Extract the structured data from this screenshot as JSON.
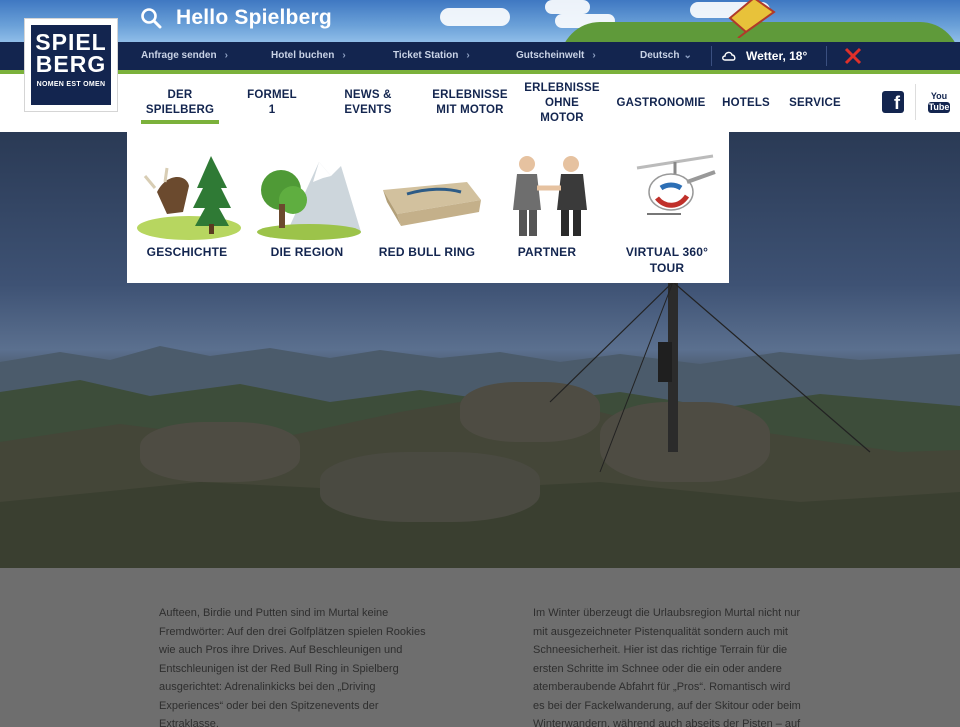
{
  "search": {
    "icon": "search-icon",
    "greeting": "Hello Spielberg"
  },
  "utility": {
    "links": [
      "Anfrage senden",
      "Hotel buchen",
      "Ticket Station",
      "Gutscheinwelt"
    ],
    "language": "Deutsch",
    "weather": "Wetter, 18°",
    "close_icon": "close-icon"
  },
  "logo": {
    "line1": "SPIEL",
    "line2": "BERG",
    "tagline": "NOMEN EST OMEN"
  },
  "nav": {
    "items": [
      {
        "label": "DER SPIELBERG",
        "active": true
      },
      {
        "label": "FORMEL 1"
      },
      {
        "label": "NEWS & EVENTS"
      },
      {
        "label": "ERLEBNISSE\nMIT MOTOR"
      },
      {
        "label": "ERLEBNISSE\nOHNE MOTOR"
      },
      {
        "label": "GASTRONOMIE"
      },
      {
        "label": "HOTELS"
      },
      {
        "label": "SERVICE"
      }
    ],
    "facebook_icon": "facebook-icon",
    "youtube": {
      "you": "You",
      "tube": "Tube"
    }
  },
  "dropdown": {
    "items": [
      {
        "label": "GESCHICHTE",
        "icon": "bull-and-tree-icon"
      },
      {
        "label": "DIE REGION",
        "icon": "tree-and-mountain-icon"
      },
      {
        "label": "RED BULL RING",
        "icon": "race-track-icon"
      },
      {
        "label": "PARTNER",
        "icon": "handshake-icon"
      },
      {
        "label": "VIRTUAL 360° TOUR",
        "icon": "helicopter-icon"
      }
    ]
  },
  "content": {
    "left": "Aufteen, Birdie und Putten sind im Murtal keine Fremdwörter: Auf den drei Golfplätzen spielen Rookies wie auch Pros ihre Drives. Auf Beschleunigen und Entschleunigen ist der Red Bull Ring in Spielberg ausgerichtet: Adrenalinkicks bei den „Driving Experiences“ oder bei den Spitzenevents der Extraklasse.",
    "right": "Im Winter überzeugt die Urlaubsregion Murtal nicht nur mit ausgezeichneter Pistenqualität sondern auch mit Schneesicherheit. Hier ist das richtige Terrain für die ersten Schritte im Schnee oder die ein oder andere atemberaubende Abfahrt für „Pros“. Romantisch wird es bei der Fackelwanderung, auf der Skitour oder beim Winterwandern, während auch abseits der Pisten – auf"
  },
  "colors": {
    "navy": "#13254f",
    "green": "#7bb13b"
  }
}
